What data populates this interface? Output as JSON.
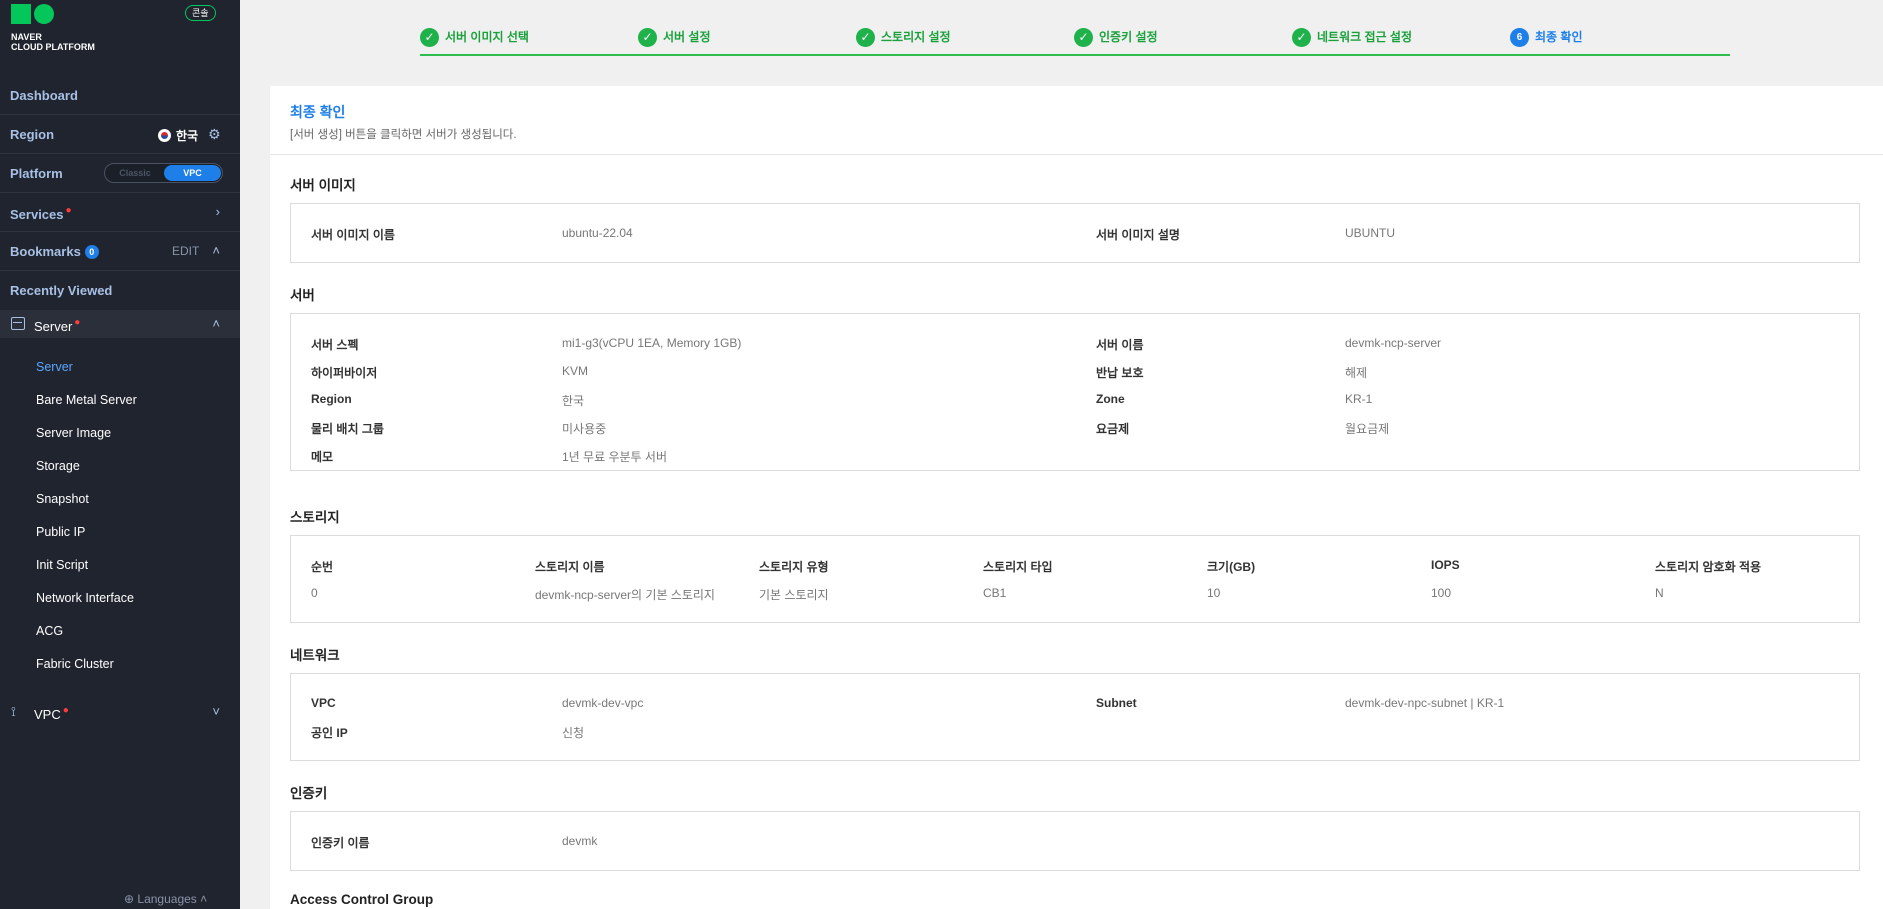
{
  "sidebar": {
    "logo_line1": "NAVER",
    "logo_line2": "CLOUD PLATFORM",
    "console_badge": "콘솔",
    "dashboard": "Dashboard",
    "region_label": "Region",
    "region_value": "한국",
    "platform_label": "Platform",
    "platform_classic": "Classic",
    "platform_vpc": "VPC",
    "services_label": "Services",
    "bookmarks_label": "Bookmarks",
    "bookmarks_count": "0",
    "bookmarks_edit": "EDIT",
    "recently_viewed": "Recently Viewed",
    "server_label": "Server",
    "server_items": [
      "Server",
      "Bare Metal Server",
      "Server Image",
      "Storage",
      "Snapshot",
      "Public IP",
      "Init Script",
      "Network Interface",
      "ACG",
      "Fabric Cluster"
    ],
    "vpc_label": "VPC",
    "languages": "Languages"
  },
  "steps": [
    {
      "label": "서버 이미지 선택",
      "state": "done"
    },
    {
      "label": "서버 설정",
      "state": "done"
    },
    {
      "label": "스토리지 설정",
      "state": "done"
    },
    {
      "label": "인증키 설정",
      "state": "done"
    },
    {
      "label": "네트워크 접근 설정",
      "state": "done"
    },
    {
      "label": "최종 확인",
      "state": "current",
      "number": "6"
    }
  ],
  "panel": {
    "title": "최종 확인",
    "subtitle": "[서버 생성] 버튼을 클릭하면 서버가 생성됩니다."
  },
  "server_image": {
    "title": "서버 이미지",
    "name_label": "서버 이미지 이름",
    "name_value": "ubuntu-22.04",
    "desc_label": "서버 이미지 설명",
    "desc_value": "UBUNTU"
  },
  "server": {
    "title": "서버",
    "spec_label": "서버 스펙",
    "spec_value": "mi1-g3(vCPU 1EA, Memory 1GB)",
    "name_label": "서버 이름",
    "name_value": "devmk-ncp-server",
    "hyper_label": "하이퍼바이저",
    "hyper_value": "KVM",
    "protect_label": "반납 보호",
    "protect_value": "해제",
    "region_label": "Region",
    "region_value": "한국",
    "zone_label": "Zone",
    "zone_value": "KR-1",
    "placement_label": "물리 배치 그룹",
    "placement_value": "미사용중",
    "fee_label": "요금제",
    "fee_value": "월요금제",
    "memo_label": "메모",
    "memo_value": "1년 무료 우분투 서버"
  },
  "storage": {
    "title": "스토리지",
    "headers": [
      "순번",
      "스토리지 이름",
      "스토리지 유형",
      "스토리지 타입",
      "크기(GB)",
      "IOPS",
      "스토리지 암호화 적용"
    ],
    "row": [
      "0",
      "devmk-ncp-server의 기본 스토리지",
      "기본 스토리지",
      "CB1",
      "10",
      "100",
      "N"
    ]
  },
  "network": {
    "title": "네트워크",
    "vpc_label": "VPC",
    "vpc_value": "devmk-dev-vpc",
    "subnet_label": "Subnet",
    "subnet_value": "devmk-dev-npc-subnet | KR-1",
    "ip_label": "공인 IP",
    "ip_value": "신청"
  },
  "auth": {
    "title": "인증키",
    "key_label": "인증키 이름",
    "key_value": "devmk"
  },
  "acg": {
    "title": "Access Control Group"
  },
  "colors": {
    "sidebar_bg": "#20242e",
    "accent_blue": "#1e7fe8",
    "step_green": "#1fb14a"
  }
}
